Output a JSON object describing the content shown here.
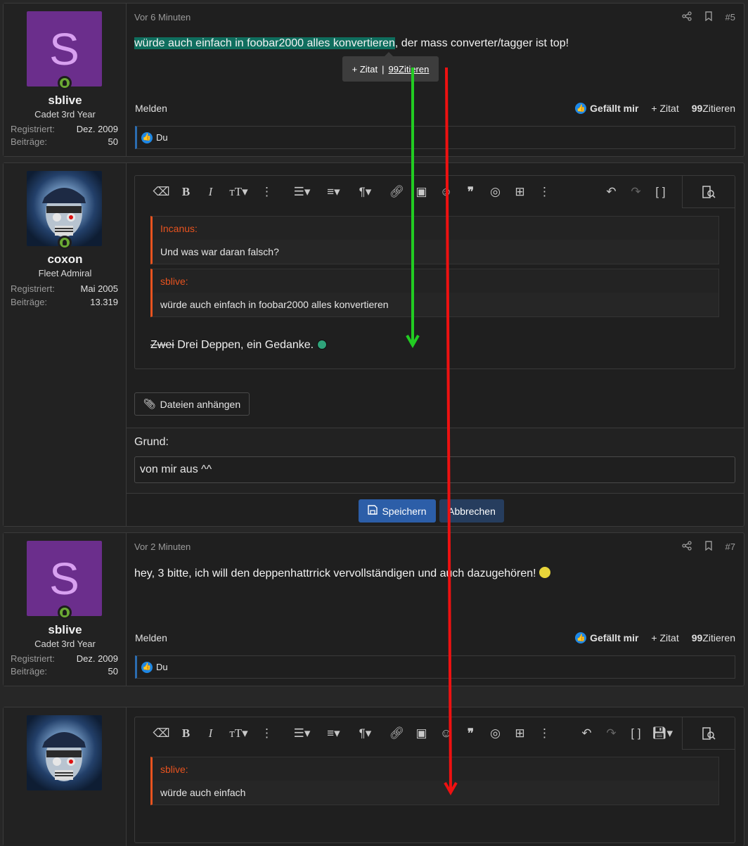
{
  "popup": {
    "add_quote": "Zitat",
    "separator": "|",
    "reply": "Zitieren"
  },
  "post5": {
    "avatar_letter": "S",
    "username": "sblive",
    "user_title": "Cadet 3rd Year",
    "registered_label": "Registriert:",
    "registered_value": "Dez. 2009",
    "posts_label": "Beiträge:",
    "posts_value": "50",
    "time": "Vor 6 Minuten",
    "number": "#5",
    "text_highlight": "würde auch einfach in foobar2000 alles konvertieren",
    "text_rest": ", der mass converter/tagger ist top!",
    "report": "Melden",
    "like": "Gefällt mir",
    "quote": "Zitat",
    "reply": "Zitieren",
    "likers": "Du"
  },
  "post6": {
    "username": "coxon",
    "user_title": "Fleet Admiral",
    "registered_label": "Registriert:",
    "registered_value": "Mai 2005",
    "posts_label": "Beiträge:",
    "posts_value": "13.319",
    "quote1_author": "Incanus:",
    "quote1_text": "Und was war daran falsch?",
    "quote2_author": "sblive:",
    "quote2_text": "würde auch einfach in foobar2000 alles konvertieren",
    "strike_text": "Zwei",
    "body_text": " Drei Deppen, ein Gedanke.",
    "attach_label": "Dateien anhängen",
    "reason_label": "Grund:",
    "reason_value": "von mir aus ^^",
    "save_label": "Speichern",
    "cancel_label": "Abbrechen"
  },
  "post7": {
    "avatar_letter": "S",
    "username": "sblive",
    "user_title": "Cadet 3rd Year",
    "registered_label": "Registriert:",
    "registered_value": "Dez. 2009",
    "posts_label": "Beiträge:",
    "posts_value": "50",
    "time": "Vor 2 Minuten",
    "number": "#7",
    "text": "hey, 3 bitte, ich will den deppenhattrrick vervollständigen und auch dazugehören!",
    "report": "Melden",
    "like": "Gefällt mir",
    "quote": "Zitat",
    "reply": "Zitieren",
    "likers": "Du"
  },
  "reply_editor": {
    "quote_author": "sblive:",
    "quote_text": "würde auch einfach"
  },
  "colors": {
    "accent_orange": "#e8531f",
    "highlight": "#0f6e5e",
    "arrow_green": "#22cc22",
    "arrow_red": "#ee1111"
  }
}
